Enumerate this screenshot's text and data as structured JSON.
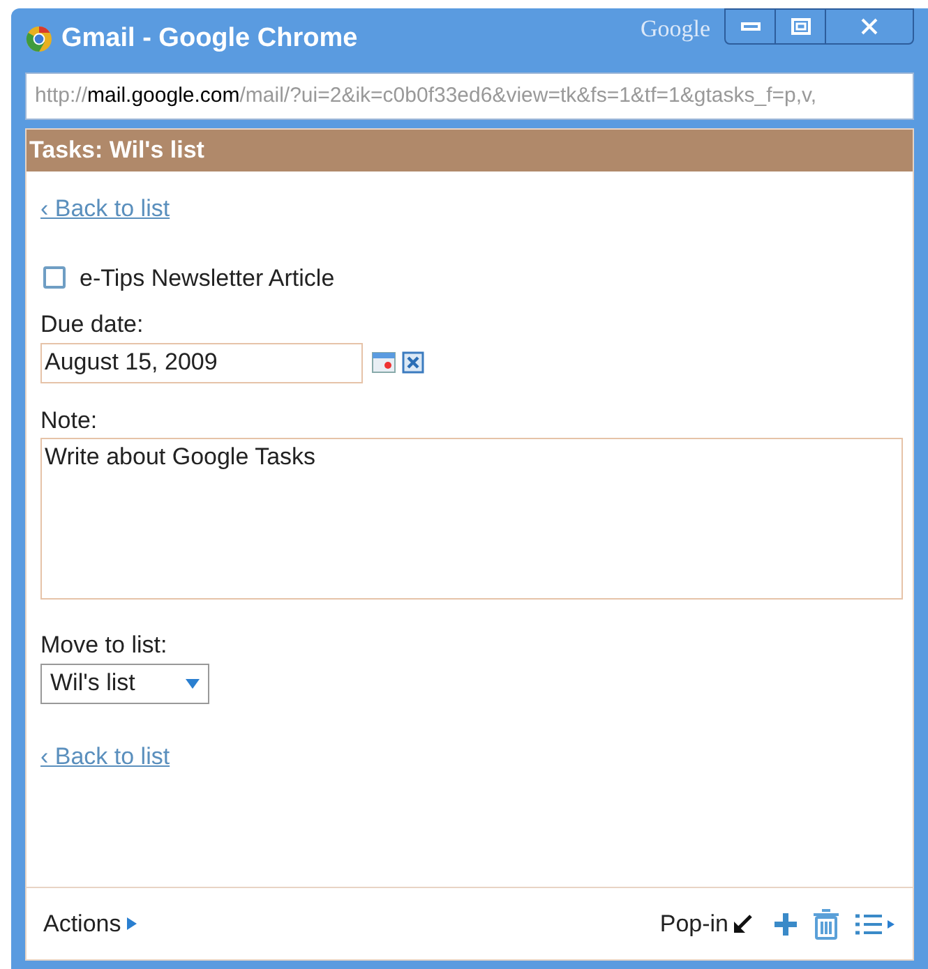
{
  "window": {
    "title": "Gmail - Google Chrome",
    "brand": "Google"
  },
  "address_bar": {
    "prefix": "http://",
    "host": "mail.google.com",
    "rest": "/mail/?ui=2&ik=c0b0f33ed6&view=tk&fs=1&tf=1&gtasks_f=p,v,"
  },
  "header": "Tasks: Wil's list",
  "back_link_top": "‹ Back to list",
  "task": {
    "title": "e-Tips Newsletter Article",
    "checked": false
  },
  "due_date": {
    "label": "Due date:",
    "value": "August 15, 2009"
  },
  "note": {
    "label": "Note:",
    "value": "Write about Google Tasks"
  },
  "move_to_list": {
    "label": "Move to list:",
    "value": "Wil's list"
  },
  "back_link_bottom": "‹ Back to list",
  "footer": {
    "actions": "Actions",
    "popin": "Pop-in"
  }
}
